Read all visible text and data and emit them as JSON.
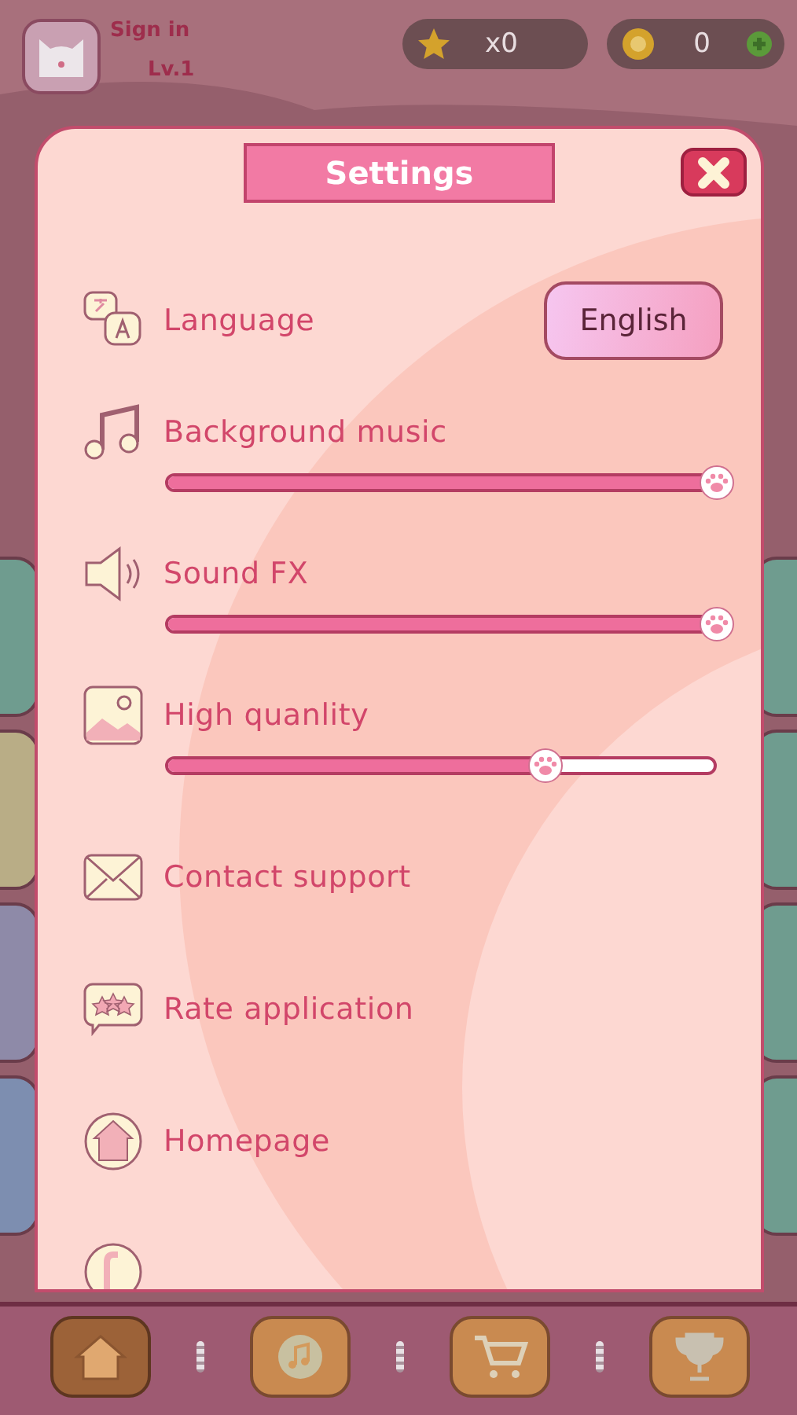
{
  "profile": {
    "sign_in": "Sign in",
    "level": "Lv.1"
  },
  "counters": [
    {
      "kind": "star",
      "amount": "x0"
    },
    {
      "kind": "coin",
      "amount": "0"
    }
  ],
  "dialog": {
    "title": "Settings",
    "rows": [
      {
        "kind": "choice",
        "label": "Language",
        "value": "English"
      },
      {
        "kind": "slider",
        "label": "Background music",
        "level": 1
      },
      {
        "kind": "slider",
        "label": "Sound FX",
        "level": 1
      },
      {
        "kind": "slider",
        "label": "High quanlity",
        "level": 0.69
      },
      {
        "kind": "link",
        "label": "Contact support"
      },
      {
        "kind": "link",
        "label": "Rate application"
      },
      {
        "kind": "link",
        "label": "Homepage"
      }
    ]
  },
  "nav": [
    {
      "selected": true
    },
    {
      "selected": false
    },
    {
      "selected": false
    },
    {
      "selected": false
    }
  ]
}
